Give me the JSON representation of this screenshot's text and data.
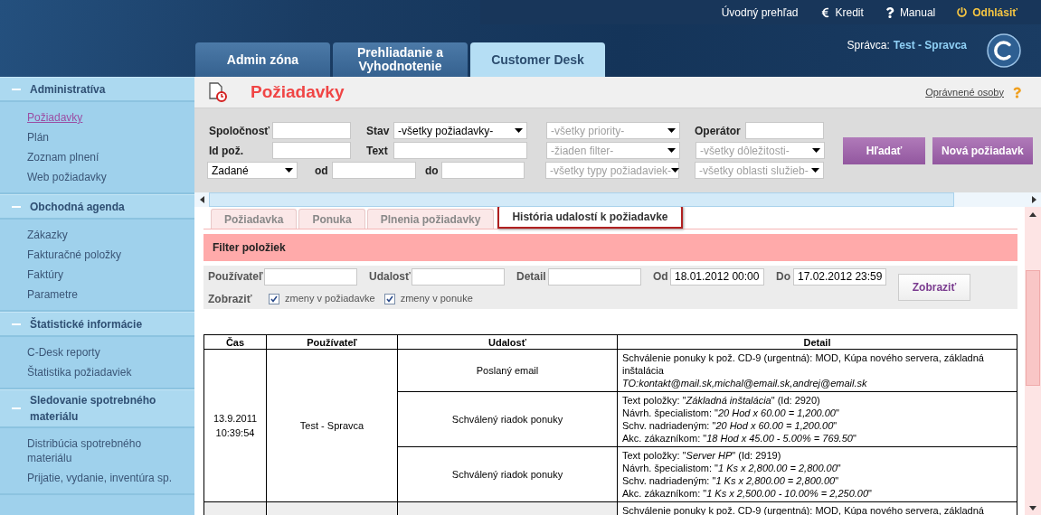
{
  "top_links": [
    {
      "label": "Úvodný prehľad",
      "kind": "plain"
    },
    {
      "label": "Kredit",
      "kind": "euro"
    },
    {
      "label": "Manual",
      "kind": "help"
    },
    {
      "label": "Odhlásiť",
      "kind": "power"
    }
  ],
  "main_tabs": [
    {
      "label": "Admin zóna",
      "selected": false
    },
    {
      "label": "Prehliadanie a Vyhodnotenie",
      "selected": false
    },
    {
      "label": "Customer Desk",
      "selected": true
    }
  ],
  "user": {
    "label": "Správca:",
    "name": "Test - Spravca"
  },
  "sidebar": [
    {
      "title": "Administratíva",
      "expanded": true,
      "items": [
        {
          "label": "Požiadavky",
          "selected": true
        },
        {
          "label": "Plán",
          "selected": false
        },
        {
          "label": "Zoznam plnení",
          "selected": false
        },
        {
          "label": "Web požiadavky",
          "selected": false
        }
      ]
    },
    {
      "title": "Obchodná agenda",
      "expanded": true,
      "items": [
        {
          "label": "Zákazky",
          "selected": false
        },
        {
          "label": "Fakturačné položky",
          "selected": false
        },
        {
          "label": "Faktúry",
          "selected": false
        },
        {
          "label": "Parametre",
          "selected": false
        }
      ]
    },
    {
      "title": "Štatistické informácie",
      "expanded": true,
      "items": [
        {
          "label": "C-Desk reporty",
          "selected": false
        },
        {
          "label": "Štatistika požiadaviek",
          "selected": false
        }
      ]
    },
    {
      "title": "Sledovanie spotrebného materiálu",
      "expanded": true,
      "items": [
        {
          "label": "Distribúcia spotrebného materiálu",
          "selected": false
        },
        {
          "label": "Prijatie, vydanie, inventúra sp.",
          "selected": false
        }
      ]
    }
  ],
  "page": {
    "title": "Požiadavky",
    "link": "Oprávnené osoby"
  },
  "search": {
    "company_label": "Spoločnosť",
    "state_label": "Stav",
    "state_value": "-všetky požiadavky-",
    "priority": "-všetky priority-",
    "operator_label": "Operátor",
    "id_label": "Id pož.",
    "text_label": "Text",
    "filter": "-žiaden filter-",
    "importance": "-všetky dôležitosti-",
    "period": "Zadané",
    "from_label": "od",
    "to_label": "do",
    "types": "-všetky typy požiadaviek-",
    "areas": "-všetky oblasti služieb-",
    "search_button": "Hľadať",
    "new_button": "Nová požiadavk"
  },
  "detail_tabs": [
    {
      "label": "Požiadavka",
      "selected": false
    },
    {
      "label": "Ponuka",
      "selected": false
    },
    {
      "label": "Plnenia požiadavky",
      "selected": false
    },
    {
      "label": "História udalostí k požiadavke",
      "selected": true
    }
  ],
  "filter": {
    "title": "Filter položiek",
    "user_label": "Používateľ",
    "event_label": "Udalosť",
    "detail_label": "Detail",
    "from_label": "Od",
    "from_value": "18.01.2012 00:00",
    "to_label": "Do",
    "to_value": "17.02.2012 23:59",
    "show_label": "Zobraziť",
    "checks": [
      {
        "label": "zmeny v požiadavke",
        "checked": true
      },
      {
        "label": "zmeny v ponuke",
        "checked": true
      }
    ],
    "button": "Zobraziť"
  },
  "table": {
    "columns": [
      "Čas",
      "Používateľ",
      "Udalosť",
      "Detail"
    ],
    "groups": [
      {
        "time": "13.9.2011 10:39:54",
        "user": "Test - Spravca",
        "events": [
          {
            "event": "Poslaný email",
            "detail": [
              "Schválenie ponuky k pož. CD-9 (urgentná): MOD, Kúpa nového servera, základná inštalácia",
              "*TO:kontakt@mail.sk,michal@email.sk,andrej@email.sk*"
            ]
          },
          {
            "event": "Schválený riadok ponuky",
            "detail": [
              "Text položky: \"*Základná inštalácia*\" (Id: 2920)",
              "Návrh. špecialistom: \"*20 Hod x 60.00 = 1,200.00*\"",
              "Schv. nadriadeným: \"*20 Hod x 60.00 = 1,200.00*\"",
              "Akc. zákazníkom: \"*18 Hod x 45.00 - 5.00% = 769.50*\""
            ]
          },
          {
            "event": "Schválený riadok ponuky",
            "detail": [
              "Text položky: \"*Server HP*\" (Id: 2919)",
              "Návrh. špecialistom: \"*1 Ks x 2,800.00 = 2,800.00*\"",
              "Schv. nadriadeným: \"*1 Ks x 2,800.00 = 2,800.00*\"",
              "Akc. zákazníkom: \"*1 Ks x 2,500.00 - 10.00% = 2,250.00*\""
            ]
          }
        ]
      },
      {
        "events": [
          {
            "detail": [
              "Schválenie ponuky k pož. CD-9 (urgentná): MOD, Kúpa nového servera, základná"
            ]
          }
        ]
      }
    ]
  }
}
